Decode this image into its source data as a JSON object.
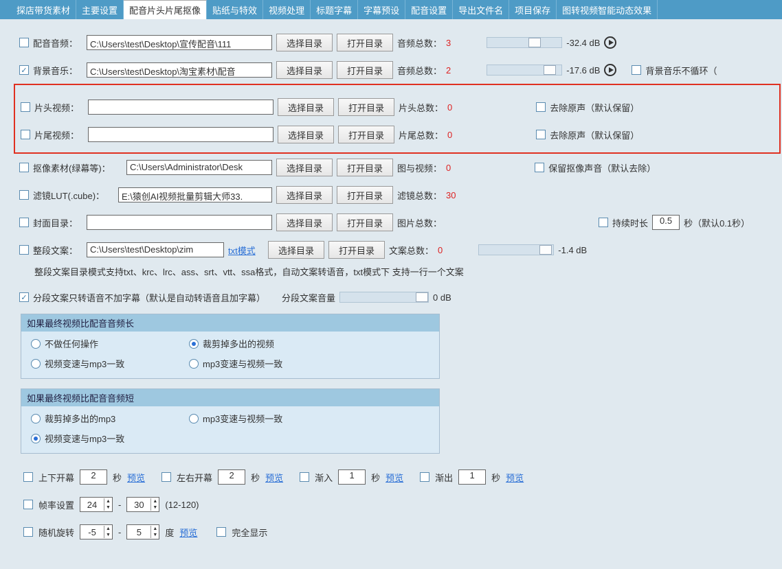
{
  "tabs": {
    "t0": "探店带货素材",
    "t1": "主要设置",
    "t2": "配音片头片尾抠像",
    "t3": "贴纸与特效",
    "t4": "视频处理",
    "t5": "标题字幕",
    "t6": "字幕预设",
    "t7": "配音设置",
    "t8": "导出文件名",
    "t9": "项目保存",
    "t10": "图转视频智能动态效果"
  },
  "rows": {
    "audio": {
      "label": "配音音频：",
      "path": "C:\\Users\\test\\Desktop\\宣传配音\\111",
      "select": "选择目录",
      "open": "打开目录",
      "count_label": "音频总数：",
      "count": "3",
      "db": "-32.4 dB"
    },
    "bgm": {
      "label": "背景音乐：",
      "path": "C:\\Users\\test\\Desktop\\淘宝素材\\配音",
      "select": "选择目录",
      "open": "打开目录",
      "count_label": "音频总数：",
      "count": "2",
      "db": "-17.6 dB",
      "noloop": "背景音乐不循环（"
    },
    "opening": {
      "label": "片头视频：",
      "path": "",
      "select": "选择目录",
      "open": "打开目录",
      "count_label": "片头总数：",
      "count": "0",
      "mute": "去除原声（默认保留）"
    },
    "ending": {
      "label": "片尾视频：",
      "path": "",
      "select": "选择目录",
      "open": "打开目录",
      "count_label": "片尾总数：",
      "count": "0",
      "mute": "去除原声（默认保留）"
    },
    "matte": {
      "label": "抠像素材(绿幕等)：",
      "path": "C:\\Users\\Administrator\\Desk",
      "select": "选择目录",
      "open": "打开目录",
      "count_label": "图与视频：",
      "count": "0",
      "keep": "保留抠像声音（默认去除）"
    },
    "lut": {
      "label": "滤镜LUT(.cube)：",
      "path": "E:\\猿创AI视频批量剪辑大师33.",
      "select": "选择目录",
      "open": "打开目录",
      "count_label": "滤镜总数：",
      "count": "30"
    },
    "cover": {
      "label": "封面目录：",
      "path": "",
      "select": "选择目录",
      "open": "打开目录",
      "count_label": "图片总数：",
      "count": "",
      "duration_lbl": "持续时长",
      "duration_val": "0.5",
      "duration_suffix": "秒（默认0.1秒）"
    },
    "copy": {
      "label": "整段文案：",
      "path": "C:\\Users\\test\\Desktop\\zim",
      "txtmode": "txt模式",
      "select": "选择目录",
      "open": "打开目录",
      "count_label": "文案总数：",
      "count": "0",
      "db": "-1.4 dB"
    }
  },
  "hint": "整段文案目录模式支持txt、krc、lrc、ass、srt、vtt、ssa格式，自动文案转语音，txt模式下 支持一行一个文案",
  "segment": {
    "label": "分段文案只转语音不加字幕（默认是自动转语音且加字幕）",
    "vol_label": "分段文案音量",
    "vol_db": "0 dB"
  },
  "grp_long": {
    "title": "如果最终视频比配音音频长",
    "o1": "不做任何操作",
    "o2": "裁剪掉多出的视频",
    "o3": "视频变速与mp3一致",
    "o4": "mp3变速与视频一致"
  },
  "grp_short": {
    "title": "如果最终视频比配音音频短",
    "o1": "裁剪掉多出的mp3",
    "o2": "mp3变速与视频一致",
    "o3": "视频变速与mp3一致"
  },
  "bottom": {
    "ud_label": "上下开幕",
    "ud_val": "2",
    "sec": "秒",
    "lr_label": "左右开幕",
    "lr_val": "2",
    "fadein_label": "渐入",
    "fadein_val": "1",
    "fadeout_label": "渐出",
    "fadeout_val": "1",
    "preview": "预览",
    "fps_label": "帧率设置",
    "fps_min": "24",
    "fps_max": "30",
    "fps_range": "(12-120)",
    "rot_label": "随机旋转",
    "rot_min": "-5",
    "rot_max": "5",
    "deg": "度",
    "fullshow": "完全显示",
    "dash": "-"
  }
}
